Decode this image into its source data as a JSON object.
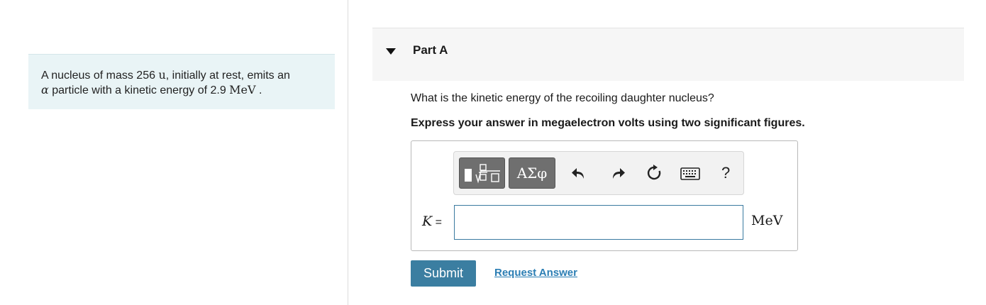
{
  "problem": {
    "text_1": "A nucleus of mass 256 ",
    "unit_u": "u",
    "text_2": ", initially at rest, emits an",
    "alpha": "α",
    "text_3": " particle with a kinetic energy of 2.9 ",
    "unit_mev": "MeV",
    "text_4": " ."
  },
  "part": {
    "title": "Part A",
    "question": "What is the kinetic energy of the recoiling daughter nucleus?",
    "instruction": "Express your answer in megaelectron volts using two significant figures."
  },
  "toolbar": {
    "greek_label": "ΑΣφ",
    "help_label": "?",
    "icons": [
      "templates-icon",
      "undo-icon",
      "redo-icon",
      "reset-icon",
      "keyboard-icon",
      "help-icon"
    ]
  },
  "answer": {
    "variable": "K",
    "equals": " =",
    "value": "",
    "unit": "MeV"
  },
  "actions": {
    "submit_label": "Submit",
    "request_label": "Request Answer"
  },
  "colors": {
    "problem_bg": "#e9f4f6",
    "submit_bg": "#3b7ea1",
    "link": "#2b7eb4",
    "input_border": "#3a7aa0"
  }
}
